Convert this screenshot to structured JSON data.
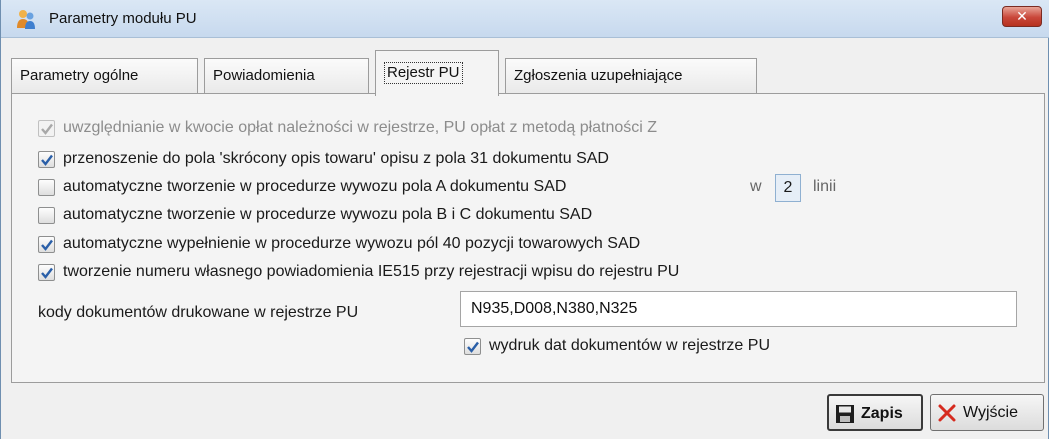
{
  "window": {
    "title": "Parametry modułu PU",
    "close_label": "✕",
    "app_icon": "people-icon"
  },
  "tabs": [
    {
      "label": "Parametry ogólne",
      "active": false
    },
    {
      "label": "Powiadomienia",
      "active": false
    },
    {
      "label": "Rejestr PU",
      "active": true
    },
    {
      "label": "Zgłoszenia uzupełniające",
      "active": false
    }
  ],
  "options": [
    {
      "label": "uwzględnianie w kwocie opłat należności w rejestrze, PU opłat z metodą płatności Z",
      "checked": true,
      "enabled": false
    },
    {
      "label": "przenoszenie do pola 'skrócony opis towaru' opisu z pola 31 dokumentu SAD",
      "checked": true,
      "enabled": true
    },
    {
      "label": "automatyczne tworzenie w procedurze wywozu pola A dokumentu SAD",
      "checked": false,
      "enabled": true
    },
    {
      "label": "automatyczne tworzenie w procedurze wywozu pola B i C dokumentu SAD",
      "checked": false,
      "enabled": true
    },
    {
      "label": "automatyczne wypełnienie w procedurze wywozu pól 40 pozycji towarowych SAD",
      "checked": true,
      "enabled": true
    },
    {
      "label": "tworzenie numeru własnego powiadomienia IE515 przy rejestracji wpisu do rejestru PU",
      "checked": true,
      "enabled": true
    }
  ],
  "lines_setting": {
    "prefix": "w",
    "value": "2",
    "suffix": "linii"
  },
  "codes": {
    "label": "kody dokumentów drukowane w rejestrze PU",
    "value": "N935,D008,N380,N325"
  },
  "print_dates": {
    "label": "wydruk dat dokumentów w rejestrze PU",
    "checked": true
  },
  "buttons": {
    "save_label": "Zapis",
    "exit_label": "Wyjście"
  },
  "colors": {
    "accent": "#2a5fa8",
    "check": "#2a5fa8",
    "close_red": "#c9473a"
  }
}
